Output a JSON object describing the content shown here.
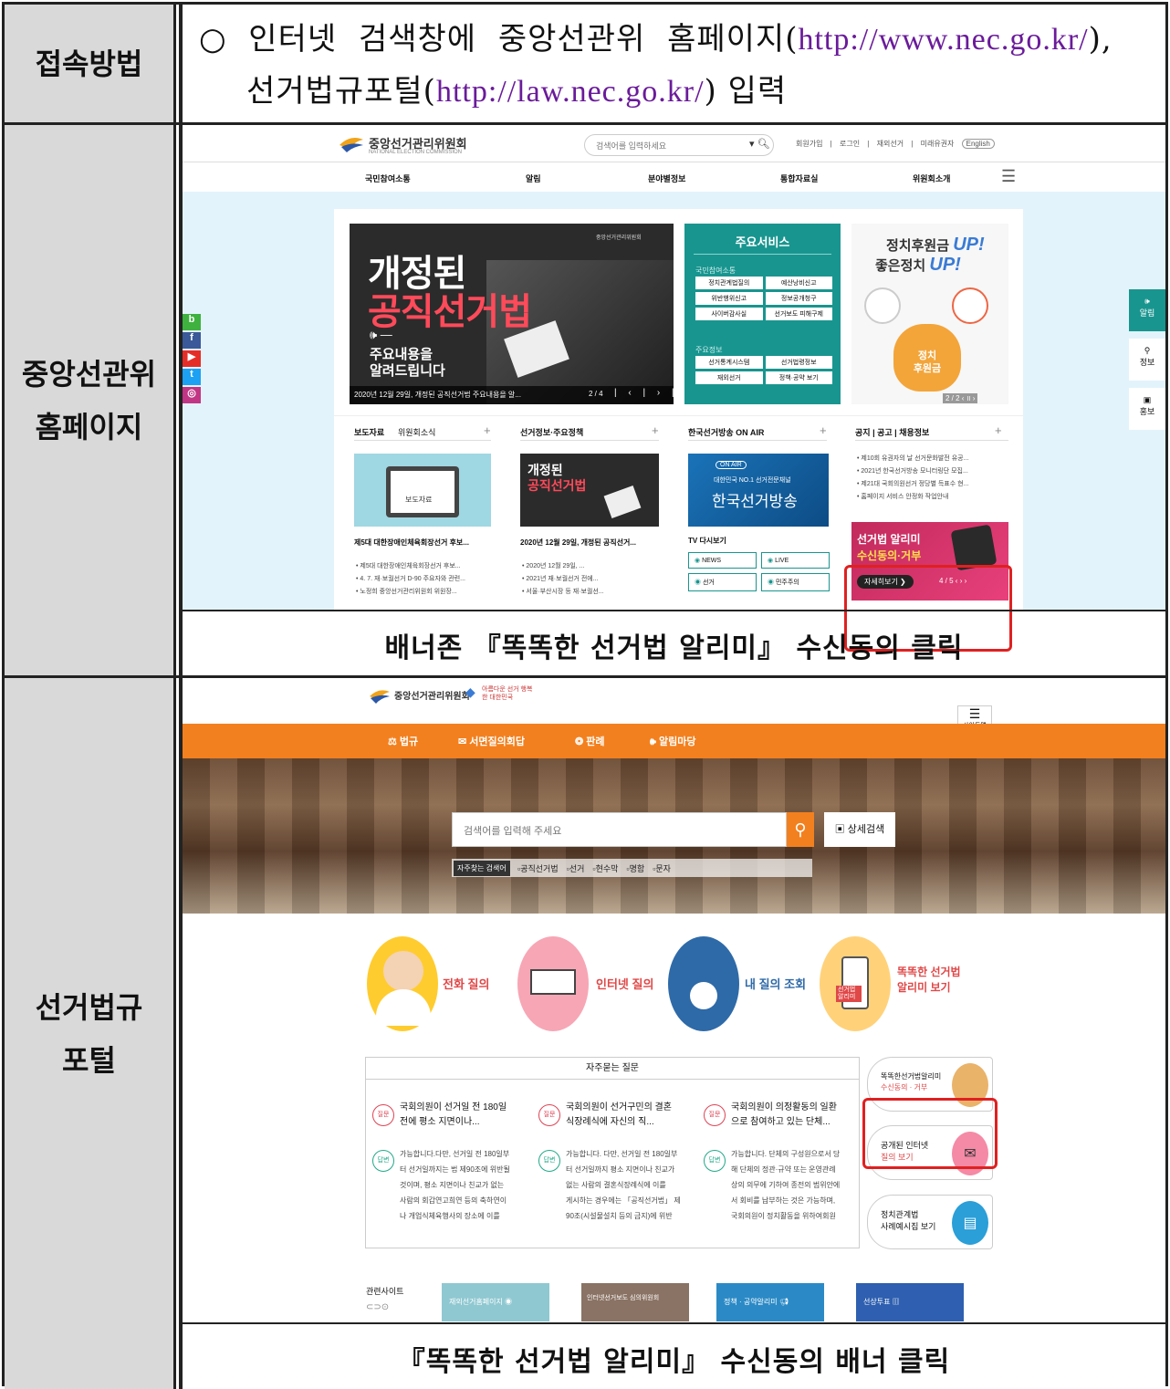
{
  "rows": {
    "access": {
      "label": "접속방법",
      "bullet": "○",
      "text1": "인터넷 검색창에 중앙선관위 홈페이지(",
      "url1": "http://www.nec.go.kr/",
      "text2": "),",
      "text3": "선거법규포털(",
      "url2": "http://law.nec.go.kr/",
      "text4": ") 입력"
    },
    "nec": {
      "label1": "중앙선관위",
      "label2": "홈페이지",
      "caption": "배너존 『똑똑한 선거법 알리미』 수신동의 클릭"
    },
    "law": {
      "label1": "선거법규",
      "label2": "포털",
      "caption": "『똑똑한 선거법 알리미』 수신동의 배너 클릭"
    }
  },
  "nec_site": {
    "logo": "중앙선거관리위원회",
    "logo_sub": "NATIONAL ELECTION COMMISSION",
    "search_placeholder": "검색어를 입력하세요",
    "util": [
      "회원가입",
      "로그인",
      "재외선거",
      "미래유권자",
      "English"
    ],
    "nav": [
      "국민참여소통",
      "알림",
      "분야별정보",
      "통합자료실",
      "위원회소개"
    ],
    "hero": {
      "title1": "개정된",
      "title2": "공직선거법",
      "sub1": "주요내용을",
      "sub2": "알려드립니다",
      "caption": "2020년 12월 29일, 개정된 공직선거법 주요내용을 알...",
      "pager": "2 / 4",
      "org": "중앙선거관리위원회"
    },
    "services": {
      "title": "주요서비스",
      "g1": "국민참여소통",
      "b1": [
        "정치관계법질의",
        "예산낭비신고",
        "위반행위신고",
        "정보공개청구",
        "사이버감사실",
        "선거보도 피해구제"
      ],
      "g2": "주요정보",
      "b2": [
        "선거통계시스템",
        "선거법령정보",
        "재외선거",
        "정책·공약 보기"
      ]
    },
    "fund": {
      "line1": "정치후원금",
      "up": "UP!",
      "line2": "좋은정치",
      "bag1": "정치",
      "bag2": "후원금",
      "pager": "2 / 2"
    },
    "side": [
      "알림",
      "정보",
      "홍보"
    ],
    "social": [
      "b",
      "f",
      "▶",
      "t",
      "◎"
    ],
    "news": {
      "tabs": [
        "보도자료",
        "위원회소식"
      ],
      "thumb": "보도자료",
      "headline": "제5대 대한장애인체육회장선거 후보...",
      "items": [
        "제5대 대한장애인체육회장선거 후보...",
        "4. 7. 재·보궐선거 D-90 주요자와 관련...",
        "노정희 중앙선거관리위원회 위원장..."
      ]
    },
    "policy": {
      "tab": "선거정보·주요정책",
      "t1": "개정된",
      "t2": "공직선거법",
      "headline": "2020년 12월 29일, 개정된 공직선거...",
      "items": [
        "2020년 12월 29일, ...",
        "2021년 재·보궐선거 전에...",
        "서울·부산시장 등 재·보궐선..."
      ]
    },
    "tv": {
      "tab": "한국선거방송 ON AIR",
      "badge": "ON AIR",
      "tag": "대한민국 NO.1 선거전문채널",
      "logo": "한국선거방송",
      "headline": "TV 다시보기",
      "btns": [
        "NEWS",
        "LIVE",
        "선거",
        "민주주의"
      ]
    },
    "notice": {
      "tabs": [
        "공지",
        "공고",
        "채용정보"
      ],
      "items": [
        "제10회 유권자의 날 선거문화발전 유공...",
        "2021년 한국선거방송 모니터링단 모집...",
        "제21대 국회의원선거 정당별 득표수 현...",
        "홈페이지 서비스 안정화 작업안내"
      ]
    },
    "banner": {
      "line1": "선거법 알리미",
      "line2": "수신동의·거부",
      "btn": "자세히보기",
      "pager": "4 / 5"
    }
  },
  "law_site": {
    "logo": "중앙선거관리위원회",
    "logo2": "아름다운 선거 행복한 대한민국",
    "menu_label": "사이트맵",
    "nav": [
      "법규",
      "서면질의회답",
      "판례",
      "알림마당"
    ],
    "search_placeholder": "검색어를 입력해 주세요",
    "adv": "상세검색",
    "hot_label": "자주찾는 검색어",
    "hot": [
      "공직선거법",
      "선거",
      "현수막",
      "명함",
      "문자"
    ],
    "quick": [
      "전화 질의",
      "인터넷 질의",
      "내 질의 조회",
      "똑똑한 선거법",
      "알리미 보기"
    ],
    "phone_badge": "선거법 알리미",
    "faq_title": "자주묻는 질문",
    "q_badge": "질문",
    "a_badge": "답변",
    "faq": [
      {
        "q1": "국회의원이 선거일 전 180일",
        "q2": "전에 평소 지면이나...",
        "a": [
          "가능합니다.다만, 선거일 전 180일부",
          "터 선거일까지는 법 제90조에 위반될",
          "것이며, 평소 지면이나 친교가 없는",
          "사람의 회갑연고희연 등의 축하연이",
          "나 개업식체육행사의 장소에 이를"
        ]
      },
      {
        "q1": "국회의원이 선거구민의 결혼",
        "q2": "식장례식에 자신의 직...",
        "a": [
          "가능합니다. 다만, 선거일 전 180일부",
          "터 선거일까지 평소 지면이나 친교가",
          "없는 사람의 결혼식장례식에 이를",
          "게시하는 경우에는 「공직선거법」 제",
          "90조(시설물설치 등의 금지)에 위반"
        ]
      },
      {
        "q1": "국회의원이 의정활동의 일환",
        "q2": "으로 참여하고 있는 단체...",
        "a": [
          "가능합니다. 단체의 구성원으로서 당",
          "해 단체의 정관·규약 또는 운영관례",
          "상의 의무에 기하여 종전의 범위안에",
          "서 회비를 납부하는 것은 가능하며,",
          "국회의원이 정치활동을 위하여회원"
        ]
      }
    ],
    "side_cards": [
      {
        "l1": "똑똑한선거법알리미",
        "l2": "수신동의 · 거부"
      },
      {
        "l1": "공개된 인터넷",
        "l2": "질의 보기"
      },
      {
        "l1": "정치관계법",
        "l2": "사례예시집 보기"
      }
    ],
    "related_label": "관련사이트",
    "related": [
      "재외선거홈페이지",
      "인터넷선거보도 심의위원회",
      "정책 · 공약알리미",
      "선상투표"
    ]
  },
  "colors": {
    "teal": "#19958f",
    "orange": "#f3801e",
    "highlight": "#e02020",
    "label_bg": "#d9d9d9"
  }
}
